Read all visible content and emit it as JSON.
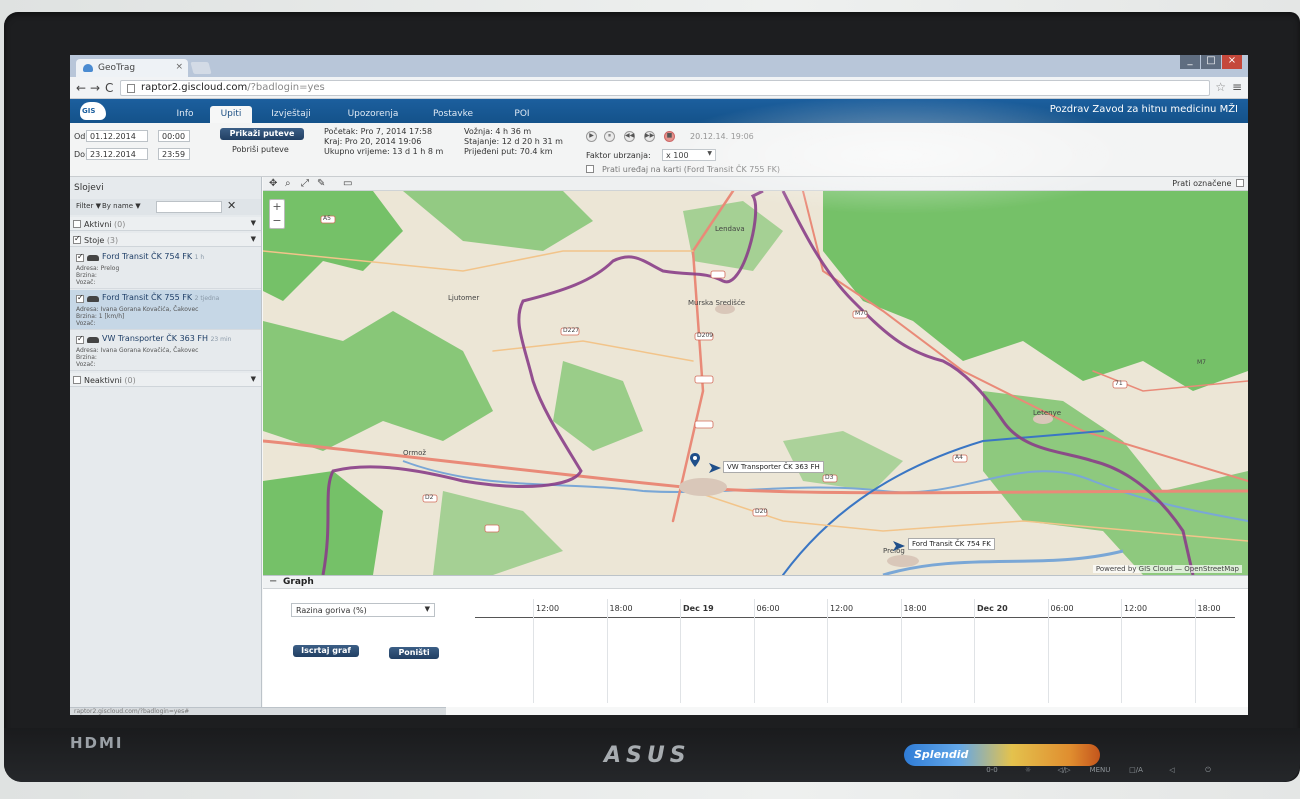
{
  "browser": {
    "tab_title": "GeoTrag",
    "tab_close": "×",
    "url_host": "raptor2.giscloud.com",
    "url_path": "/?badlogin=yes",
    "back": "←",
    "forward": "→",
    "reload": "C",
    "star": "☆",
    "menu": "≡",
    "window_controls": [
      "_",
      "□",
      "×"
    ]
  },
  "app": {
    "logo_text": "GIS",
    "tabs": [
      "Info",
      "Upiti",
      "Izvještaji",
      "Upozorenja",
      "Postavke",
      "POI"
    ],
    "active_tab": "Upiti",
    "greeting": "Pozdrav Zavod za hitnu medicinu MŽI"
  },
  "query": {
    "from_label": "Od:",
    "from_date": "01.12.2014",
    "from_time": "00:00",
    "to_label": "Do:",
    "to_date": "23.12.2014",
    "to_time": "23:59",
    "show_routes": "Prikaži puteve",
    "clear_routes": "Pobriši puteve"
  },
  "stats": {
    "start": "Početak: Pro 7, 2014 17:58",
    "end": "Kraj: Pro 20, 2014 19:06",
    "total_time": "Ukupno vrijeme: 13 d 1 h 8 m",
    "driving": "Vožnja: 4 h 36 m",
    "stopped": "Stajanje: 12 d 20 h 31 m",
    "distance": "Prijeđeni put: 70.4 km"
  },
  "playback": {
    "buttons": [
      "▶",
      "⏸",
      "◀◀",
      "▶▶",
      "■"
    ],
    "time": "20.12.14. 19:06",
    "speed_label": "Faktor ubrzanja:",
    "speed_value": "x 100",
    "follow_label": "Prati uređaj na karti (Ford Transit ČK 755 FK)"
  },
  "sidebar": {
    "title": "Slojevi",
    "filter_label": "Filter",
    "sort_label": "By name",
    "clear": "✕",
    "groups": {
      "active": {
        "label": "Aktivni",
        "count": "(0)"
      },
      "stopped": {
        "label": "Stoje",
        "count": "(3)"
      },
      "inactive": {
        "label": "Neaktivni",
        "count": "(0)"
      }
    },
    "vehicles": [
      {
        "name": "Ford Transit ČK 754 FK",
        "age": "1 h",
        "address": "Adresa: Prelog",
        "speed": "Brzina:",
        "driver": "Vozač:"
      },
      {
        "name": "Ford Transit ČK 755 FK",
        "age": "2 tjedna",
        "address": "Adresa: Ivana Gorana Kovačića, Čakovec",
        "speed": "Brzina: 1 [km/h]",
        "driver": "Vozač:"
      },
      {
        "name": "VW Transporter ČK 363 FH",
        "age": "23 min",
        "address": "Adresa: Ivana Gorana Kovačića, Čakovec",
        "speed": "Brzina:",
        "driver": "Vozač:"
      }
    ]
  },
  "map": {
    "follow_marked": "Prati označene",
    "zoom_in": "+",
    "zoom_out": "−",
    "places": [
      "Lendava",
      "Murska Središće",
      "Letenye",
      "Ormož",
      "Ljutomer",
      "Prelog"
    ],
    "road_labels": [
      "A5",
      "M70",
      "D209",
      "D227",
      "D3",
      "A4",
      "D20",
      "D2",
      "71",
      "M7"
    ],
    "vehicle_labels": [
      "VW Transporter ČK 363 FH",
      "Ford Transit ČK 754 FK"
    ],
    "attribution": "Powered by GIS Cloud — OpenStreetMap",
    "colors": {
      "land": "#ece6d6",
      "forest": "#6fbf62",
      "border": "#8a3e88",
      "road_main": "#e98a78",
      "road_secondary": "#f2c48a"
    }
  },
  "graph": {
    "tab_label": "Graph",
    "collapse": "−",
    "metric": "Razina goriva (%)",
    "draw_button": "Iscrtaj graf",
    "cancel_button": "Poništi",
    "ticks": [
      {
        "label": "12:00",
        "bold": false
      },
      {
        "label": "18:00",
        "bold": false
      },
      {
        "label": "Dec 19",
        "bold": true
      },
      {
        "label": "06:00",
        "bold": false
      },
      {
        "label": "12:00",
        "bold": false
      },
      {
        "label": "18:00",
        "bold": false
      },
      {
        "label": "Dec 20",
        "bold": true
      },
      {
        "label": "06:00",
        "bold": false
      },
      {
        "label": "12:00",
        "bold": false
      },
      {
        "label": "18:00",
        "bold": false
      }
    ]
  },
  "statusbar": "raptor2.giscloud.com/?badlogin=yes#",
  "monitor": {
    "brand": "ASUS",
    "port": "HDMI",
    "preset": "Splendid",
    "buttons": [
      "0-0",
      "☼",
      "◁/▷",
      "MENU",
      "□/A",
      "◁",
      "⏻"
    ]
  }
}
